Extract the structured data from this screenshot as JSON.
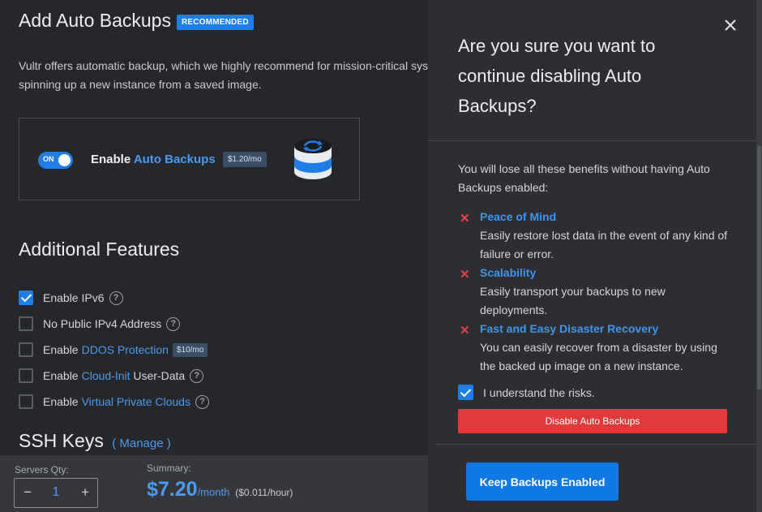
{
  "backups": {
    "title": "Add Auto Backups",
    "badge": "RECOMMENDED",
    "description_line1": "Vultr offers automatic backup, which we highly recommend for mission-critical sys",
    "description_line2": "spinning up a new instance from a saved image.",
    "toggle_label": "ON",
    "toggle_on": true,
    "enable_prefix": "Enable",
    "enable_link": "Auto Backups",
    "price": "$1.20/mo"
  },
  "features": {
    "title": "Additional Features",
    "items": [
      {
        "prefix": "Enable IPv6",
        "link": "",
        "suffix": "",
        "checked": true,
        "help": true,
        "badge": ""
      },
      {
        "prefix": "No Public IPv4 Address",
        "link": "",
        "suffix": "",
        "checked": false,
        "help": true,
        "badge": ""
      },
      {
        "prefix": "Enable",
        "link": "DDOS Protection",
        "suffix": "",
        "checked": false,
        "help": false,
        "badge": "$10/mo"
      },
      {
        "prefix": "Enable",
        "link": "Cloud-Init",
        "suffix": " User-Data",
        "checked": false,
        "help": true,
        "badge": ""
      },
      {
        "prefix": "Enable",
        "link": "Virtual Private Clouds",
        "suffix": "",
        "checked": false,
        "help": true,
        "badge": ""
      }
    ]
  },
  "ssh": {
    "title": "SSH Keys",
    "manage": "( Manage )"
  },
  "bottom": {
    "qty_label": "Servers Qty:",
    "qty_minus": "−",
    "qty_value": "1",
    "qty_plus": "+",
    "summary_label": "Summary:",
    "price": "$7.20",
    "period": "/month",
    "hourly": "($0.011/hour)"
  },
  "modal": {
    "title": "Are you sure you want to continue disabling Auto Backups?",
    "intro": "You will lose all these benefits without having Auto Backups enabled:",
    "benefits": [
      {
        "title": "Peace of Mind",
        "desc": "Easily restore lost data in the event of any kind of failure or error."
      },
      {
        "title": "Scalability",
        "desc": "Easily transport your backups to new deployments."
      },
      {
        "title": "Fast and Easy Disaster Recovery",
        "desc": "You can easily recover from a disaster by using the backed up image on a new instance."
      }
    ],
    "understand": "I understand the risks.",
    "understand_checked": true,
    "disable_button": "Disable Auto Backups",
    "keep_button": "Keep Backups Enabled"
  },
  "colors": {
    "accent": "#1e7ee6",
    "danger": "#e23a3a",
    "link": "#4a9bf2"
  }
}
